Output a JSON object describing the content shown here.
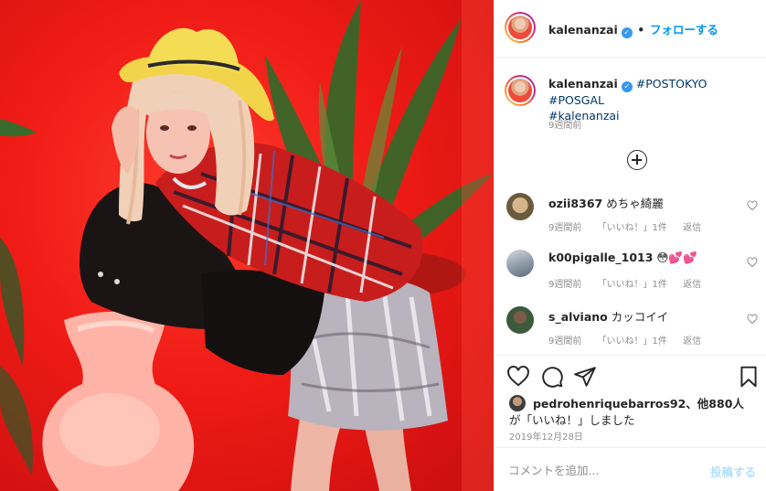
{
  "header": {
    "username": "kalenanzai",
    "separator": "•",
    "follow_label": "フォローする",
    "verified_icon": "verified-badge-icon"
  },
  "caption": {
    "username": "kalenanzai",
    "hashtags": [
      "#POSTOKYO",
      "#POSGAL",
      "#kalenanzai"
    ],
    "time": "9週間前"
  },
  "load_more_icon": "plus-circle-icon",
  "comments": [
    {
      "username": "ozii8367",
      "text": "めちゃ綺麗",
      "time": "9週間前",
      "likes": "「いいね！」1件",
      "reply": "返信"
    },
    {
      "username": "k00pigalle_1013",
      "text": "😳💕💕",
      "time": "9週間前",
      "likes": "「いいね！」1件",
      "reply": "返信"
    },
    {
      "username": "s_alviano",
      "text": "カッコイイ",
      "time": "9週間前",
      "likes": "「いいね！」1件",
      "reply": "返信"
    }
  ],
  "actions": {
    "icons": [
      "heart-icon",
      "comment-icon",
      "share-icon",
      "bookmark-icon"
    ],
    "liked_by_user": "pedrohenriquebarros92",
    "liked_by_rest": "、他880人",
    "liked_line2": "が「いいね！」しました",
    "date": "2019年12月28日"
  },
  "add_comment": {
    "placeholder": "コメントを追加...",
    "post_label": "投稿する"
  },
  "colors": {
    "accent": "#0095f6",
    "hashtag": "#00376b",
    "muted": "#8e8e8e",
    "photo_background": "#ef1b16"
  }
}
